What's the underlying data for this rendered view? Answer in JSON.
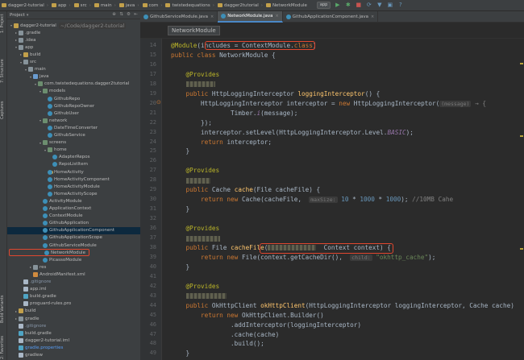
{
  "navbar": {
    "breadcrumbs": [
      "dagger2-tutorial",
      "app",
      "src",
      "main",
      "java",
      "com",
      "twistedequations",
      "dagger2tutorial",
      "NetworkModule"
    ],
    "run_config": "app",
    "toolbar_icons": [
      "run-icon",
      "debug-icon",
      "stop-icon",
      "sync-icon",
      "sdk-icon",
      "avd-icon",
      "help-icon"
    ]
  },
  "left_strip": {
    "tabs": [
      "1: Project",
      "7: Structure",
      "Captures",
      "Build Variants",
      "2: Favorites"
    ]
  },
  "project_panel": {
    "title": "Project",
    "chevron": "▾",
    "tree": [
      {
        "depth": 0,
        "arrow": "▾",
        "icon": "ofolder",
        "label": "dagger2-tutorial",
        "hint": "~/Code/dagger2-tutorial"
      },
      {
        "depth": 1,
        "arrow": "▸",
        "icon": "folder",
        "label": ".gradle"
      },
      {
        "depth": 1,
        "arrow": "▸",
        "icon": "folder",
        "label": ".idea"
      },
      {
        "depth": 1,
        "arrow": "▾",
        "icon": "folder",
        "label": "app"
      },
      {
        "depth": 2,
        "arrow": "▸",
        "icon": "ofolder",
        "label": "build"
      },
      {
        "depth": 2,
        "arrow": "▾",
        "icon": "folder",
        "label": "src"
      },
      {
        "depth": 3,
        "arrow": "▾",
        "icon": "folder",
        "label": "main"
      },
      {
        "depth": 4,
        "arrow": "▾",
        "icon": "bfolder",
        "label": "java"
      },
      {
        "depth": 5,
        "arrow": "▾",
        "icon": "pkg",
        "label": "com.twistedequations.dagger2tutorial"
      },
      {
        "depth": 6,
        "arrow": "▾",
        "icon": "pkg",
        "label": "models"
      },
      {
        "depth": 7,
        "arrow": "",
        "icon": "cls",
        "label": "GithubRepo"
      },
      {
        "depth": 7,
        "arrow": "",
        "icon": "cls",
        "label": "GithubRepoOwner"
      },
      {
        "depth": 7,
        "arrow": "",
        "icon": "cls",
        "label": "GithubUser"
      },
      {
        "depth": 6,
        "arrow": "▾",
        "icon": "pkg",
        "label": "network"
      },
      {
        "depth": 7,
        "arrow": "",
        "icon": "cls",
        "label": "DateTimeConverter"
      },
      {
        "depth": 7,
        "arrow": "",
        "icon": "cls",
        "label": "GithubService"
      },
      {
        "depth": 6,
        "arrow": "▾",
        "icon": "pkg",
        "label": "screens"
      },
      {
        "depth": 7,
        "arrow": "▾",
        "icon": "pkg",
        "label": "home"
      },
      {
        "depth": 8,
        "arrow": "",
        "icon": "cls",
        "label": "AdapterRepos"
      },
      {
        "depth": 8,
        "arrow": "",
        "icon": "cls",
        "label": "RepoListItem"
      },
      {
        "depth": 7,
        "arrow": "",
        "icon": "act",
        "label": "HomeActivity"
      },
      {
        "depth": 7,
        "arrow": "",
        "icon": "cls",
        "label": "HomeActivityComponent"
      },
      {
        "depth": 7,
        "arrow": "",
        "icon": "cls",
        "label": "HomeActivityModule"
      },
      {
        "depth": 7,
        "arrow": "",
        "icon": "cls",
        "label": "HomeActivityScope"
      },
      {
        "depth": 6,
        "arrow": "",
        "icon": "cls",
        "label": "ActivityModule"
      },
      {
        "depth": 6,
        "arrow": "",
        "icon": "cls",
        "label": "ApplicationContext"
      },
      {
        "depth": 6,
        "arrow": "",
        "icon": "cls",
        "label": "ContextModule"
      },
      {
        "depth": 6,
        "arrow": "",
        "icon": "cls",
        "label": "GithubApplication"
      },
      {
        "depth": 6,
        "arrow": "",
        "icon": "cls",
        "label": "GithubApplicationComponent",
        "selected": true
      },
      {
        "depth": 6,
        "arrow": "",
        "icon": "cls",
        "label": "GithubApplicationScope"
      },
      {
        "depth": 6,
        "arrow": "",
        "icon": "cls",
        "label": "GithubServiceModule"
      },
      {
        "depth": 6,
        "arrow": "",
        "icon": "cls",
        "label": "NetworkModule",
        "highlighted": true
      },
      {
        "depth": 6,
        "arrow": "",
        "icon": "cls",
        "label": "PicassoModule"
      },
      {
        "depth": 4,
        "arrow": "▸",
        "icon": "folder",
        "label": "res"
      },
      {
        "depth": 4,
        "arrow": "",
        "icon": "xml",
        "label": "AndroidManifest.xml"
      },
      {
        "depth": 2,
        "arrow": "",
        "icon": "file",
        "label": ".gitignore",
        "git": true
      },
      {
        "depth": 2,
        "arrow": "",
        "icon": "file",
        "label": "app.iml"
      },
      {
        "depth": 2,
        "arrow": "",
        "icon": "grad",
        "label": "build.gradle"
      },
      {
        "depth": 2,
        "arrow": "",
        "icon": "file",
        "label": "proguard-rules.pro"
      },
      {
        "depth": 1,
        "arrow": "▸",
        "icon": "ofolder",
        "label": "build"
      },
      {
        "depth": 1,
        "arrow": "▸",
        "icon": "folder",
        "label": "gradle"
      },
      {
        "depth": 1,
        "arrow": "",
        "icon": "file",
        "label": ".gitignore",
        "git": true
      },
      {
        "depth": 1,
        "arrow": "",
        "icon": "grad",
        "label": "build.gradle"
      },
      {
        "depth": 1,
        "arrow": "",
        "icon": "file",
        "label": "dagger2-tutorial.iml"
      },
      {
        "depth": 1,
        "arrow": "",
        "icon": "grad",
        "label": "gradle.properties",
        "blue": true
      },
      {
        "depth": 1,
        "arrow": "",
        "icon": "file",
        "label": "gradlew"
      },
      {
        "depth": 1,
        "arrow": "",
        "icon": "file",
        "label": "gradlew.bat"
      },
      {
        "depth": 1,
        "arrow": "",
        "icon": "file",
        "label": "local.properties"
      }
    ]
  },
  "editor_tabs": [
    {
      "label": "GithubServiceModule.java",
      "active": false
    },
    {
      "label": "NetworkModule.java",
      "active": true
    },
    {
      "label": "GithubApplicationComponent.java",
      "active": false
    }
  ],
  "editor_breadcrumb": "NetworkModule",
  "editor": {
    "lines": [
      {
        "n": "14",
        "tokens": [
          [
            "ann",
            "@Module"
          ],
          [
            "",
            "(includes = ContextModule."
          ],
          [
            "kw",
            "class"
          ],
          [
            "",
            ")"
          ]
        ]
      },
      {
        "n": "15",
        "tokens": [
          [
            "kw",
            "public class "
          ],
          [
            "",
            "NetworkModule {"
          ]
        ]
      },
      {
        "n": "16",
        "tokens": []
      },
      {
        "n": "17",
        "tokens": [
          [
            "ann",
            "    @Provides"
          ]
        ]
      },
      {
        "n": "18",
        "tokens": [
          [
            "",
            "    "
          ],
          [
            "blur",
            "36"
          ]
        ]
      },
      {
        "n": "19",
        "tokens": [
          [
            "kw",
            "    public "
          ],
          [
            "",
            "HttpLoggingInterceptor "
          ],
          [
            "fn",
            "loggingInterceptor"
          ],
          [
            "",
            "() {"
          ]
        ]
      },
      {
        "n": "20",
        "tokens": [
          [
            "",
            "        HttpLoggingInterceptor interceptor = "
          ],
          [
            "kw",
            "new "
          ],
          [
            "",
            "HttpLoggingInterceptor("
          ],
          [
            "hint",
            "(message)"
          ],
          [
            "",
            ""
          ],
          [
            "cmt",
            " → {"
          ]
        ]
      },
      {
        "n": "21",
        "tokens": [
          [
            "",
            "                Timber."
          ],
          [
            "fld",
            "i"
          ],
          [
            "",
            "(message);"
          ]
        ]
      },
      {
        "n": "22",
        "tokens": [
          [
            "",
            "        });"
          ]
        ]
      },
      {
        "n": "23",
        "tokens": [
          [
            "",
            "        interceptor.setLevel(HttpLoggingInterceptor.Level."
          ],
          [
            "fld",
            "BASIC"
          ],
          [
            "",
            ");"
          ]
        ]
      },
      {
        "n": "24",
        "tokens": [
          [
            "kw",
            "        return "
          ],
          [
            "",
            "interceptor;"
          ]
        ]
      },
      {
        "n": "25",
        "tokens": [
          [
            "",
            "    }"
          ]
        ]
      },
      {
        "n": "26",
        "tokens": []
      },
      {
        "n": "27",
        "tokens": [
          [
            "ann",
            "    @Provides"
          ]
        ]
      },
      {
        "n": "28",
        "tokens": [
          [
            "",
            "    "
          ],
          [
            "blur",
            "30"
          ]
        ]
      },
      {
        "n": "29",
        "tokens": [
          [
            "kw",
            "    public "
          ],
          [
            "",
            "Cache "
          ],
          [
            "fn",
            "cache"
          ],
          [
            "",
            "(File cacheFile) {"
          ]
        ]
      },
      {
        "n": "30",
        "tokens": [
          [
            "kw",
            "        return new "
          ],
          [
            "",
            "Cache(cacheFile,  "
          ],
          [
            "hint",
            "maxSize:"
          ],
          [
            "num",
            " 10"
          ],
          [
            "",
            " * "
          ],
          [
            "num",
            "1000"
          ],
          [
            "",
            " * "
          ],
          [
            "num",
            "1000"
          ],
          [
            "",
            ");"
          ],
          [
            "cmt",
            " //10MB "
          ],
          [
            "cmt",
            "Cahe"
          ]
        ]
      },
      {
        "n": "31",
        "tokens": [
          [
            "",
            "    }"
          ]
        ]
      },
      {
        "n": "32",
        "tokens": []
      },
      {
        "n": "36",
        "tokens": [
          [
            "ann",
            "    @Provides"
          ]
        ]
      },
      {
        "n": "37",
        "tokens": [
          [
            "",
            "    "
          ],
          [
            "blur",
            "42"
          ]
        ]
      },
      {
        "n": "38",
        "tokens": [
          [
            "kw",
            "    public "
          ],
          [
            "",
            "File "
          ],
          [
            "fn",
            "cacheFile"
          ],
          [
            "",
            "("
          ],
          [
            "blur",
            "60"
          ],
          [
            "",
            "  Context context) {"
          ]
        ]
      },
      {
        "n": "39",
        "tokens": [
          [
            "kw",
            "        return new "
          ],
          [
            "",
            "File(context.getCacheDir(),  "
          ],
          [
            "hint",
            "child:"
          ],
          [
            "str",
            " \"okhttp_cache\""
          ],
          [
            "",
            ");"
          ]
        ]
      },
      {
        "n": "40",
        "tokens": [
          [
            "",
            "    }"
          ]
        ]
      },
      {
        "n": "41",
        "tokens": []
      },
      {
        "n": "42",
        "tokens": [
          [
            "ann",
            "    @Provides"
          ]
        ]
      },
      {
        "n": "43",
        "tokens": [
          [
            "",
            "    "
          ],
          [
            "blur",
            "50"
          ]
        ]
      },
      {
        "n": "44",
        "tokens": [
          [
            "kw",
            "    public "
          ],
          [
            "",
            "OkHttpClient "
          ],
          [
            "fn",
            "okHttpClient"
          ],
          [
            "",
            "(HttpLoggingInterceptor loggingInterceptor, Cache cache) {"
          ]
        ]
      },
      {
        "n": "45",
        "tokens": [
          [
            "kw",
            "        return new "
          ],
          [
            "",
            "OkHttpClient.Builder()"
          ]
        ]
      },
      {
        "n": "46",
        "tokens": [
          [
            "",
            "                .addInterceptor(loggingInterceptor)"
          ]
        ]
      },
      {
        "n": "47",
        "tokens": [
          [
            "",
            "                .cache(cache)"
          ]
        ]
      },
      {
        "n": "48",
        "tokens": [
          [
            "",
            "                .build();"
          ]
        ]
      },
      {
        "n": "49",
        "tokens": [
          [
            "",
            "    }"
          ]
        ]
      }
    ]
  }
}
